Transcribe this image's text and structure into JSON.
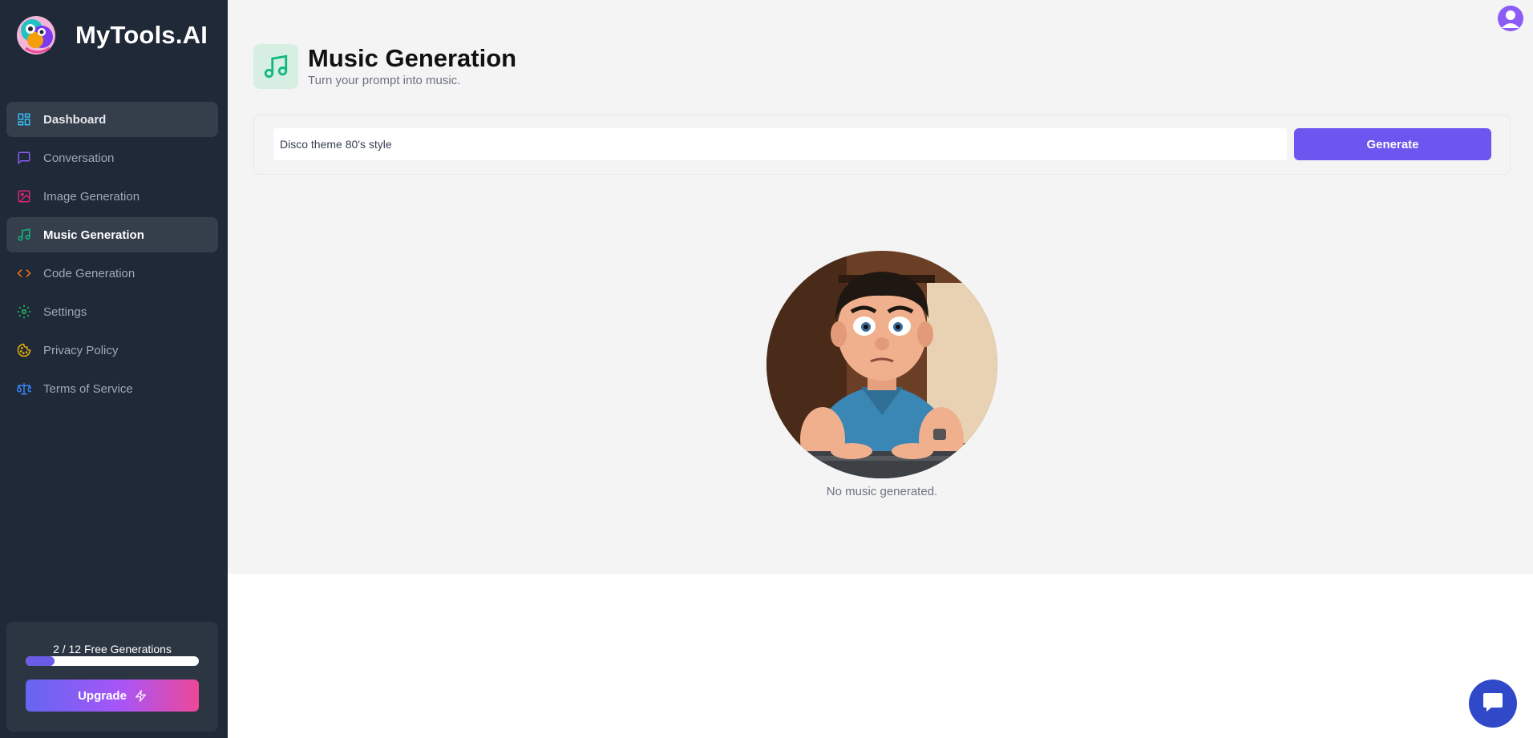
{
  "app": {
    "name": "MyTools.AI"
  },
  "sidebar": {
    "items": [
      {
        "label": "Dashboard",
        "icon": "dashboard-icon",
        "color": "#38bdf8"
      },
      {
        "label": "Conversation",
        "icon": "message-square-icon",
        "color": "#8b5cf6"
      },
      {
        "label": "Image Generation",
        "icon": "image-icon",
        "color": "#db2777"
      },
      {
        "label": "Music Generation",
        "icon": "music-icon",
        "color": "#10b981"
      },
      {
        "label": "Code Generation",
        "icon": "code-icon",
        "color": "#f97316"
      },
      {
        "label": "Settings",
        "icon": "settings-icon",
        "color": "#22c55e"
      },
      {
        "label": "Privacy Policy",
        "icon": "cookie-icon",
        "color": "#eab308"
      },
      {
        "label": "Terms of Service",
        "icon": "scale-icon",
        "color": "#3b82f6"
      }
    ],
    "active": "Music Generation"
  },
  "usage": {
    "text": "2 / 12 Free Generations",
    "used": 2,
    "limit": 12,
    "upgrade_label": "Upgrade"
  },
  "header": {
    "title": "Music Generation",
    "subtitle": "Turn your prompt into music.",
    "icon": "music-icon",
    "accent": "#10b981"
  },
  "prompt": {
    "value": "Disco theme 80's style",
    "generate_label": "Generate"
  },
  "empty_state": {
    "text": "No music generated.",
    "image": "confused-man-at-keyboard-illustration"
  },
  "colors": {
    "sidebar_bg": "#1f2937",
    "primary": "#6d56f0",
    "chat_button": "#2f49c8"
  }
}
